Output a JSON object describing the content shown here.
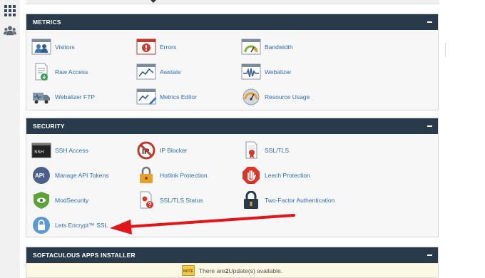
{
  "metrics": {
    "title": "METRICS",
    "items": [
      "Visitors",
      "Errors",
      "Bandwidth",
      "Raw Access",
      "Awstats",
      "Webalizer",
      "Webalizer FTP",
      "Metrics Editor",
      "Resource Usage"
    ]
  },
  "security": {
    "title": "SECURITY",
    "items": [
      "SSH Access",
      "IP Blocker",
      "SSL/TLS",
      "Manage API Tokens",
      "Hotlink Protection",
      "Leech Protection",
      "ModSecurity",
      "SSL/TLS Status",
      "Two-Factor Authentication",
      "Lets Encrypt™ SSL"
    ],
    "api_icon_text": "API",
    "ssh_icon_text": "SSH",
    "ip_icon_text": "IP"
  },
  "softaculous": {
    "title": "SOFTACULOUS APPS INSTALLER",
    "notice_pre": "There are ",
    "notice_count": "2",
    "notice_post": " Update(s) available.",
    "badge_text": "NOTE"
  },
  "colors": {
    "header_bg": "#293a4a",
    "link": "#2f6db5",
    "arrow": "#e0161b",
    "notice_bg": "#fcf8e3"
  }
}
